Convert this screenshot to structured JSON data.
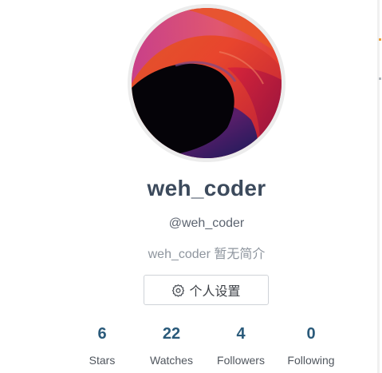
{
  "profile": {
    "avatar_alt": "user avatar",
    "username": "weh_coder",
    "handle": "@weh_coder",
    "bio": "weh_coder 暂无简介"
  },
  "actions": {
    "settings_label": "个人设置",
    "settings_icon": "gear-icon"
  },
  "stats": [
    {
      "value": "6",
      "label": "Stars"
    },
    {
      "value": "22",
      "label": "Watches"
    },
    {
      "value": "4",
      "label": "Followers"
    },
    {
      "value": "0",
      "label": "Following"
    }
  ],
  "colors": {
    "username": "#3c4a5c",
    "stat_number": "#2a5a7a",
    "avatar_ring": "#ececec"
  }
}
